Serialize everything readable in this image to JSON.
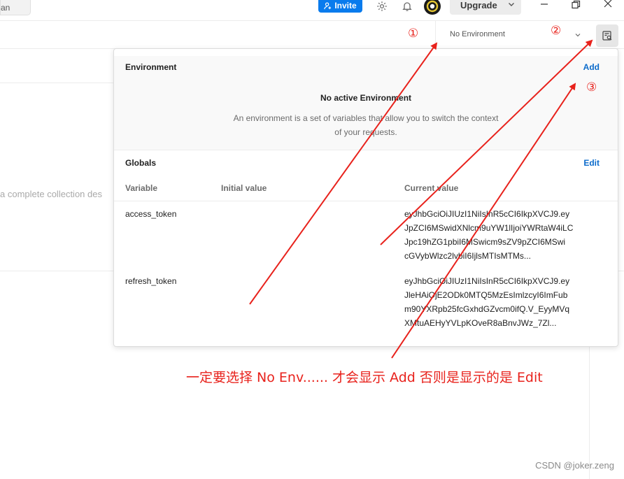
{
  "topbar": {
    "tab_stub": "an",
    "invite_label": "Invite",
    "upgrade_label": "Upgrade",
    "icons": [
      "settings-gear-icon",
      "notification-bell-icon",
      "user-avatar",
      "chevron-down-icon",
      "minimize-icon",
      "restore-icon",
      "close-icon"
    ]
  },
  "env_bar": {
    "selected_env": "No Environment",
    "quick_look_icon": "environment-quick-look-icon"
  },
  "background": {
    "hint_text": "a complete collection des"
  },
  "environment_panel": {
    "heading": "Environment",
    "add_label": "Add",
    "empty_title": "No active Environment",
    "empty_desc": "An environment is a set of variables that allow you to switch the context of your requests."
  },
  "globals_panel": {
    "heading": "Globals",
    "edit_label": "Edit",
    "columns": [
      "Variable",
      "Initial value",
      "Current value"
    ],
    "rows": [
      {
        "variable": "access_token",
        "initial_value": "",
        "current_value": "eyJhbGciOiJIUzI1NiIsInR5cCI6IkpXVCJ9.eyJpZCI6MSwidXNlcm5hbWUiOiJhZG1pbiIsImlhdCI6MTc...",
        "lines": [
          "eyJhbGciOiJIUzI1NiIsInR5cCI6IkpXVCJ9.ey",
          "JpZCI6MSwidXNlcm9uYW1lIjoiYWRtaW4iLC",
          "Jpc19hZG1pbiI6MSwicm9sZV9pZCI6MSwi",
          "cGVybWlzc2lvbiI6IjlsMTIsMTMs..."
        ]
      },
      {
        "variable": "refresh_token",
        "initial_value": "",
        "current_value": "eyJhbGciOiJIUzI1NiIsInR5cCI6IkpXVCJ9.eyJleHAiOjE2ODk0MTQ5MzEsImlzcyI6ImFubm90YXRpb25fcGxhdGZvcm0ifQ.V_EyyMVqXMtuAEHyYVLpKOveR8aBnvJWz_7Zl...",
        "lines": [
          "eyJhbGciOiJIUzI1NiIsInR5cCI6IkpXVCJ9.ey",
          "JleHAiOjE2ODk0MTQ5MzEsImlzcyI6ImFub",
          "m90YXRpb25fcGxhdGZvcm0ifQ.V_EyyMVq",
          "XMtuAEHyYVLpKOveR8aBnvJWz_7Zl..."
        ]
      }
    ]
  },
  "annotations": {
    "marker_1": "①",
    "marker_2": "②",
    "marker_3": "③",
    "caption": "一定要选择 No Env...... 才会显示 Add  否则是显示的是 Edit",
    "color": "#e8221c"
  },
  "watermark": "CSDN @joker.zeng"
}
